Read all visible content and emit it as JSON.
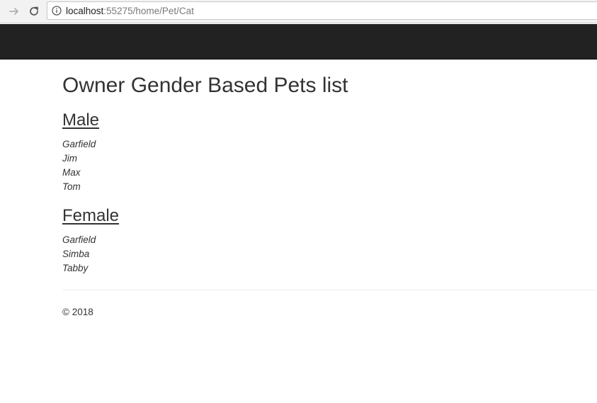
{
  "browser": {
    "url_host": "localhost",
    "url_rest": ":55275/home/Pet/Cat",
    "icons": {
      "forward": "arrow-right-icon",
      "reload": "reload-icon",
      "info": "info-icon"
    }
  },
  "main": {
    "title": "Owner Gender Based Pets list",
    "groups": [
      {
        "heading": "Male",
        "pets": [
          "Garfield",
          "Jim",
          "Max",
          "Tom"
        ]
      },
      {
        "heading": "Female",
        "pets": [
          "Garfield",
          "Simba",
          "Tabby"
        ]
      }
    ]
  },
  "footer": {
    "text": "© 2018"
  },
  "colors": {
    "navbar": "#222222",
    "text": "#333333"
  }
}
